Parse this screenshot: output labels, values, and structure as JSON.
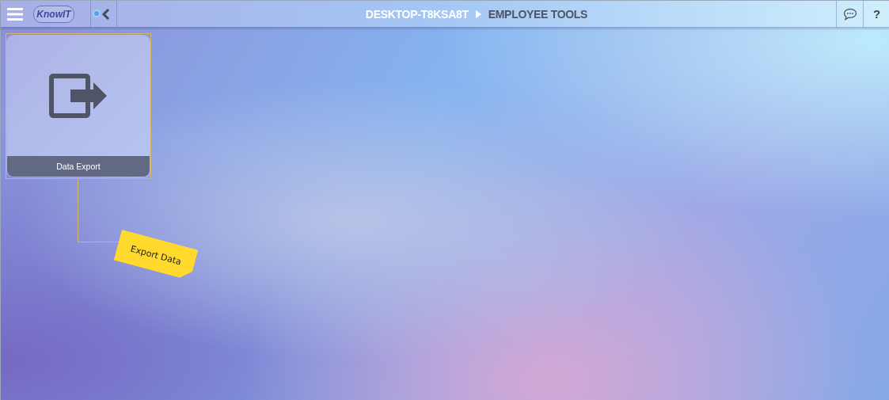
{
  "header": {
    "logo": "KnowIT",
    "help": "?",
    "breadcrumb": [
      {
        "label": "DESKTOP-T8KSA8T",
        "selected": false
      },
      {
        "label": "EMPLOYEE TOOLS",
        "selected": true
      }
    ]
  },
  "tiles": [
    {
      "label": "Data Export",
      "note": "Export Data"
    }
  ]
}
